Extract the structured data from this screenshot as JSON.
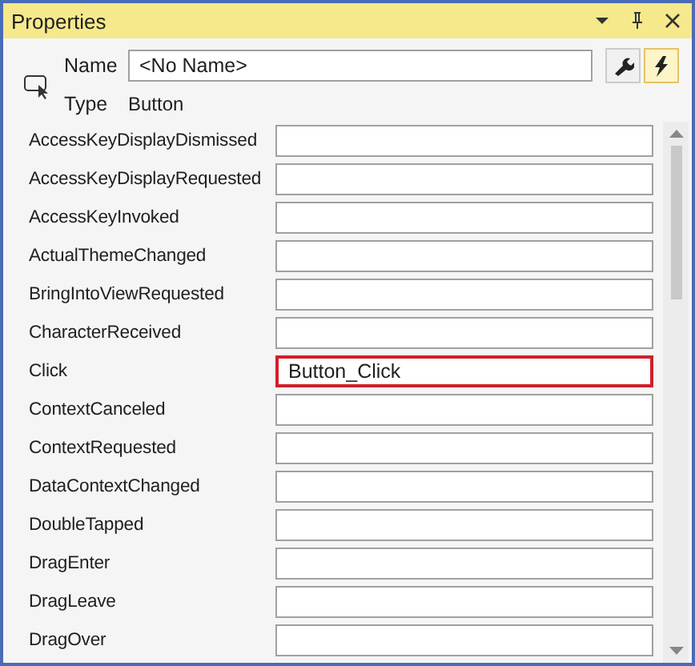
{
  "window": {
    "title": "Properties"
  },
  "header": {
    "name_label": "Name",
    "name_value": "<No Name>",
    "type_label": "Type",
    "type_value": "Button"
  },
  "view_buttons": [
    {
      "kind": "properties",
      "selected": false
    },
    {
      "kind": "events",
      "selected": true
    }
  ],
  "events": [
    {
      "name": "AccessKeyDisplayDismissed",
      "highlighted": false
    },
    {
      "name": "AccessKeyDisplayRequested",
      "highlighted": false
    },
    {
      "name": "AccessKeyInvoked",
      "highlighted": false
    },
    {
      "name": "ActualThemeChanged",
      "highlighted": false
    },
    {
      "name": "BringIntoViewRequested",
      "highlighted": false
    },
    {
      "name": "CharacterReceived",
      "highlighted": false
    },
    {
      "name": "Click",
      "value": "Button_Click",
      "highlighted": true
    },
    {
      "name": "ContextCanceled",
      "highlighted": false
    },
    {
      "name": "ContextRequested",
      "highlighted": false
    },
    {
      "name": "DataContextChanged",
      "highlighted": false
    },
    {
      "name": "DoubleTapped",
      "highlighted": false
    },
    {
      "name": "DragEnter",
      "highlighted": false
    },
    {
      "name": "DragLeave",
      "highlighted": false
    },
    {
      "name": "DragOver",
      "highlighted": false
    }
  ]
}
